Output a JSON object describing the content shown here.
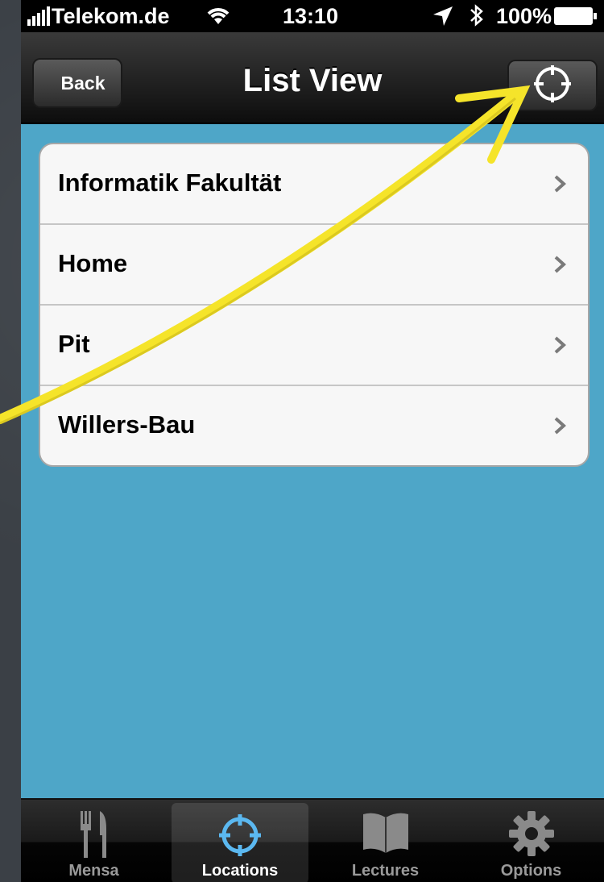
{
  "status_bar": {
    "carrier": "Telekom.de",
    "time": "13:10",
    "battery": "100%"
  },
  "navbar": {
    "back_label": "Back",
    "title": "List View",
    "locate_icon": "crosshair-icon"
  },
  "list": {
    "items": [
      {
        "label": "Informatik Fakultät"
      },
      {
        "label": "Home"
      },
      {
        "label": "Pit"
      },
      {
        "label": "Willers-Bau"
      }
    ]
  },
  "tabbar": {
    "tabs": [
      {
        "label": "Mensa",
        "icon": "fork-knife-icon"
      },
      {
        "label": "Locations",
        "icon": "crosshair-icon",
        "active": true
      },
      {
        "label": "Lectures",
        "icon": "book-icon"
      },
      {
        "label": "Options",
        "icon": "gear-icon"
      }
    ]
  },
  "colors": {
    "background": "#4ea6c8",
    "annotation_arrow": "#f5e42a"
  }
}
